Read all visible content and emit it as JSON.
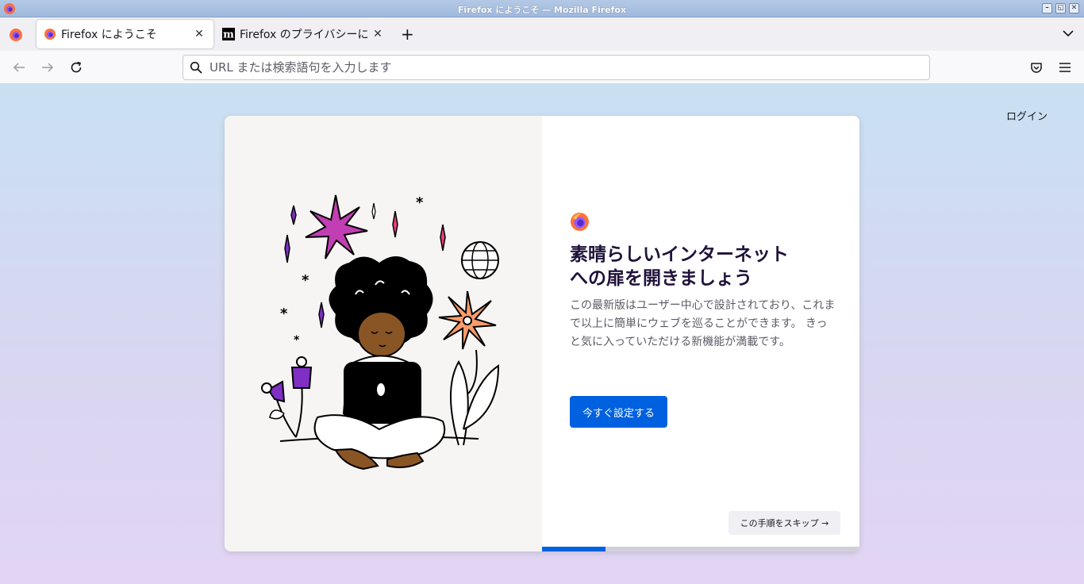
{
  "window": {
    "title": "Firefox にようこそ — Mozilla Firefox",
    "buttons": {
      "minimize": "–",
      "maximize": "◱",
      "close": "✕"
    }
  },
  "tabs": [
    {
      "label": "Firefox にようこそ",
      "icon": "firefox-icon",
      "active": true
    },
    {
      "label": "Firefox のプライバシーに",
      "icon": "mozilla-icon",
      "active": false
    }
  ],
  "tab_close_glyph": "✕",
  "new_tab_glyph": "+",
  "urlbar": {
    "placeholder": "URL または検索語句を入力します"
  },
  "page": {
    "login_label": "ログイン",
    "headline_line1": "素晴らしいインターネット",
    "headline_line2": "への扉を開きましょう",
    "description": "この最新版はユーザー中心で設計されており、これまで以上に簡単にウェブを巡ることができます。 きっと気に入っていただける新機能が満載です。",
    "primary_button": "今すぐ設定する",
    "skip_button": "この手順をスキップ →",
    "progress_fraction": 0.2
  },
  "colors": {
    "accent": "#0061e0",
    "headline": "#20123a"
  }
}
